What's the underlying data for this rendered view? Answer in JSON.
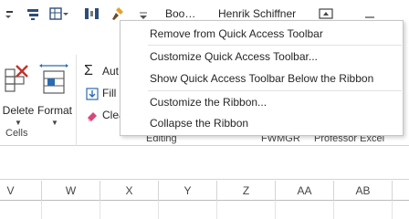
{
  "title_bar": {
    "doc_title": "Boo…",
    "user_name": "Henrik Schiffner"
  },
  "ribbon": {
    "cells_group": {
      "delete_label": "Delete",
      "format_label": "Format",
      "group_label": "Cells"
    },
    "editing_group": {
      "autosum_label": "Aut",
      "fill_label": "Fill",
      "clear_label": "Clea",
      "group_label": "Editing"
    },
    "extra_labels": {
      "fwmgr": "FWMGR",
      "professor": "Professor Excel"
    }
  },
  "context_menu": {
    "items": [
      {
        "label": "Remove from Quick Access Toolbar"
      },
      {
        "label": "Customize Quick Access Toolbar..."
      },
      {
        "label": "Show Quick Access Toolbar Below the Ribbon"
      },
      {
        "label": "Customize the Ribbon..."
      },
      {
        "label": "Collapse the Ribbon"
      }
    ]
  },
  "columns": [
    "V",
    "W",
    "X",
    "Y",
    "Z",
    "AA",
    "AB"
  ],
  "colors": {
    "delete_red": "#c4312b",
    "format_blue": "#2b6cb0",
    "eraser_pink": "#d9477a",
    "paint_gold": "#e2a22f"
  }
}
